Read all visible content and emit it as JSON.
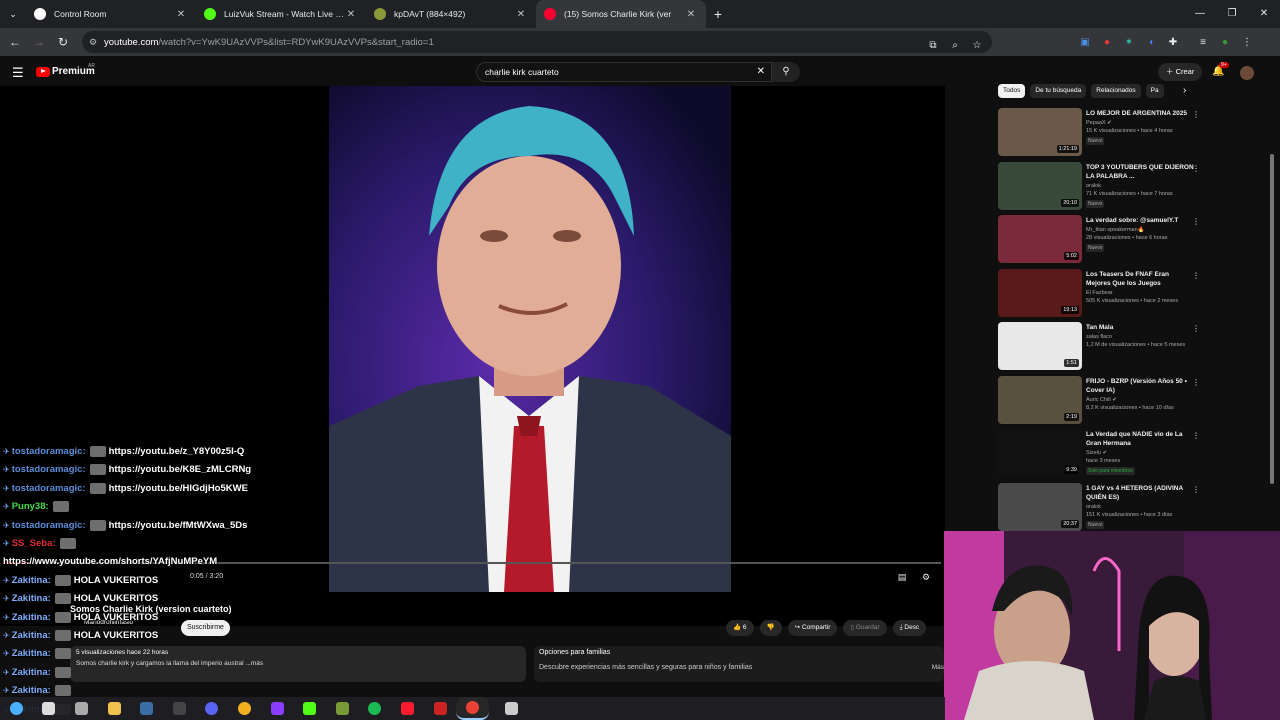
{
  "browser": {
    "tabs": [
      {
        "title": "Control Room",
        "color": "#ffffff",
        "icon": "globe-icon"
      },
      {
        "title": "LuizVuk Stream - Watch Live on",
        "color": "#53fc18",
        "icon": "kick-icon"
      },
      {
        "title": "kpDAvT (884×492)",
        "color": "#8a9a3a",
        "icon": "image-icon"
      },
      {
        "title": "(15) Somos Charlie Kirk (ver",
        "color": "#ff0033",
        "icon": "youtube-icon",
        "active": true
      }
    ],
    "new_tab": "+",
    "url_domain": "youtube.com",
    "url_path": "/watch?v=YwK9UAzVVPs&list=RDYwK9UAzVVPs&start_radio=1"
  },
  "youtube": {
    "logo_text": "Premium",
    "country": "AR",
    "search_query": "charlie kirk cuarteto",
    "create_label": "Crear",
    "notif_count": "9+",
    "chips": [
      "Todos",
      "De tu búsqueda",
      "Relacionados",
      "Pa"
    ],
    "player": {
      "time": "0:05 / 3:20",
      "progress": 0.025
    },
    "video_title": "Somos Charlie Kirk (version cuarteto)",
    "channel": "Marlodrofilinfasio",
    "subscribe": "Suscribirme",
    "likes": "6",
    "share": "Compartir",
    "save": "Guardar",
    "download": "Desc",
    "description": {
      "meta": "5 visualizaciones  hace 22 horas",
      "text": "Somos charlie kirk y cargamos la llama del imperio austral ...más"
    },
    "family": {
      "title": "Opciones para familias",
      "text": "Descubre experiencias más sencillas y seguras para niños y familias",
      "more": "Más"
    },
    "recommendations": [
      {
        "title": "LO MEJOR DE ARGENTINA 2025",
        "channel": "PepaaX ✔",
        "meta": "15 K visualizaciones • hace 4 horas",
        "badge": "Nuevo",
        "duration": "1:21:19",
        "bg": "#6b5a4a"
      },
      {
        "title": "TOP 3 YOUTUBERS QUE DIJERON LA PALABRA ...",
        "channel": "oralok",
        "meta": "71 K visualizaciones • hace 7 horas",
        "badge": "Nuevo",
        "duration": "20:10",
        "bg": "#3a4a3a"
      },
      {
        "title": "La verdad sobre: @samuelY.T",
        "channel": "Mr_titan speakerman🔥",
        "meta": "28 visualizaciones • hace 6 horas",
        "badge": "Nuevo",
        "duration": "5:02",
        "bg": "#7a2a3a"
      },
      {
        "title": "Los Teasers De FNAF Eran Mejores Que los Juegos",
        "channel": "El Fazbear",
        "meta": "505 K visualizaciones • hace 2 meses",
        "badge": "",
        "duration": "19:13",
        "bg": "#5a1a1a"
      },
      {
        "title": "Tan Mala",
        "channel": "salas flaco",
        "meta": "1,2 M de visualizaciones • hace 5 meses",
        "badge": "",
        "duration": "1:51",
        "bg": "#e8e8e8"
      },
      {
        "title": "FRIJO - BZRP (Versión Años 50 • Cover IA)",
        "channel": "Auric Chill ✔",
        "meta": "8,2 K visualizaciones • hace 10 días",
        "badge": "",
        "duration": "2:19",
        "bg": "#5a5040"
      },
      {
        "title": "La Verdad que NADIE vio de La Gran Hermana",
        "channel": "Sizeiu ✔",
        "meta": "hace 3 meses",
        "badge": "Solo para miembros",
        "duration": "9:39",
        "bg": "#111111"
      },
      {
        "title": "1 GAY vs 4 HETEROS (ADIVINA QUIÉN ES)",
        "channel": "oralok",
        "meta": "151 K visualizaciones • hace 3 días",
        "badge": "Nuevo",
        "duration": "20:37",
        "bg": "#4a4a4a"
      }
    ]
  },
  "chat": [
    {
      "user": "tostadoramagic:",
      "color": "#5b8dd9",
      "msg": "https://youtu.be/z_Y8Y00z5I-Q"
    },
    {
      "user": "tostadoramagic:",
      "color": "#5b8dd9",
      "msg": "https://youtu.be/K8E_zMLCRNg"
    },
    {
      "user": "tostadoramagic:",
      "color": "#5b8dd9",
      "msg": "https://youtu.be/HIGdjHo5KWE"
    },
    {
      "user": "Puny38:",
      "color": "#44dd44",
      "msg": ""
    },
    {
      "user": "tostadoramagic:",
      "color": "#5b8dd9",
      "msg": "https://youtu.be/fMtWXwa_5Ds"
    },
    {
      "user": "SS_Seba:",
      "color": "#e03030",
      "msg": ""
    },
    {
      "user": "",
      "color": "#ffffff",
      "msg": "https://www.youtube.com/shorts/YAfjNuMPeYM"
    },
    {
      "user": "Zakitina:",
      "color": "#7fb0ff",
      "msg": "HOLA VUKERITOS"
    },
    {
      "user": "Zakitina:",
      "color": "#7fb0ff",
      "msg": "HOLA VUKERITOS"
    },
    {
      "user": "Zakitina:",
      "color": "#7fb0ff",
      "msg": "HOLA VUKERITOS"
    },
    {
      "user": "Zakitina:",
      "color": "#7fb0ff",
      "msg": "HOLA VUKERITOS"
    },
    {
      "user": "Zakitina:",
      "color": "#7fb0ff",
      "msg": ""
    },
    {
      "user": "Zakitina:",
      "color": "#7fb0ff",
      "msg": ""
    },
    {
      "user": "Zakitina:",
      "color": "#7fb0ff",
      "msg": ""
    },
    {
      "user": "Zakitina:",
      "color": "#7fb0ff",
      "msg": ""
    }
  ],
  "taskbar": [
    {
      "name": "windows-start-icon",
      "color": "#4ab0ff"
    },
    {
      "name": "search-icon",
      "color": "#dddddd"
    },
    {
      "name": "task-view-icon",
      "color": "#aaaaaa"
    },
    {
      "name": "file-explorer-icon",
      "color": "#f2c14e"
    },
    {
      "name": "steam-icon",
      "color": "#3b6ea5"
    },
    {
      "name": "obs-icon",
      "color": "#444444"
    },
    {
      "name": "discord-icon",
      "color": "#5865f2"
    },
    {
      "name": "chrome-icon",
      "color": "#f2b01e"
    },
    {
      "name": "canva-icon",
      "color": "#8b3dff"
    },
    {
      "name": "kick-icon",
      "color": "#53fc18"
    },
    {
      "name": "minecraft-icon",
      "color": "#7a9a3a"
    },
    {
      "name": "spotify-icon",
      "color": "#1db954"
    },
    {
      "name": "opera-icon",
      "color": "#ff1b2d"
    },
    {
      "name": "app-icon",
      "color": "#cc2222"
    },
    {
      "name": "chrome-active-icon",
      "color": "#e94235"
    },
    {
      "name": "bot-icon",
      "color": "#cccccc"
    }
  ]
}
